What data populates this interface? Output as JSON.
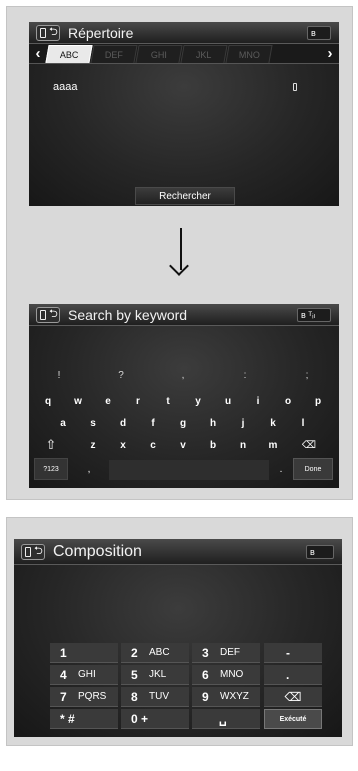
{
  "screen1": {
    "title": "Répertoire",
    "bt_icon": "bluetooth-icon",
    "tabs": [
      "ABC",
      "DEF",
      "GHI",
      "JKL",
      "MNO"
    ],
    "active_tab": "ABC",
    "entries": [
      {
        "name": "aaaa",
        "icon": "phone-icon"
      }
    ],
    "search_button": "Rechercher"
  },
  "screen2": {
    "title": "Search by keyword",
    "bt_icon": "bluetooth-icon",
    "symbol_row": [
      "!",
      "?",
      ",",
      ":",
      ";"
    ],
    "row1": [
      "q",
      "w",
      "e",
      "r",
      "t",
      "y",
      "u",
      "i",
      "o",
      "p"
    ],
    "row2": [
      "a",
      "s",
      "d",
      "f",
      "g",
      "h",
      "j",
      "k",
      "l"
    ],
    "row3": [
      "z",
      "x",
      "c",
      "v",
      "b",
      "n",
      "m"
    ],
    "shift_icon": "shift-icon",
    "backspace_icon": "backspace-icon",
    "mode_key": "?123",
    "comma_key": ",",
    "period_key": ".",
    "done_key": "Done"
  },
  "screen3": {
    "title": "Composition",
    "bt_icon": "bluetooth-icon",
    "keys": [
      {
        "digit": "1",
        "letters": ""
      },
      {
        "digit": "2",
        "letters": "ABC"
      },
      {
        "digit": "3",
        "letters": "DEF"
      },
      {
        "digit": "-",
        "letters": ""
      },
      {
        "digit": "4",
        "letters": "GHI"
      },
      {
        "digit": "5",
        "letters": "JKL"
      },
      {
        "digit": "6",
        "letters": "MNO"
      },
      {
        "digit": ".",
        "letters": ""
      },
      {
        "digit": "7",
        "letters": "PQRS"
      },
      {
        "digit": "8",
        "letters": "TUV"
      },
      {
        "digit": "9",
        "letters": "WXYZ"
      },
      {
        "digit": "",
        "letters": ""
      },
      {
        "digit": "* #",
        "letters": ""
      },
      {
        "digit": "0 +",
        "letters": ""
      },
      {
        "digit": "␣",
        "letters": ""
      },
      {
        "digit": "Exécuté",
        "letters": ""
      }
    ]
  },
  "arrow_icon": "down-arrow-icon"
}
